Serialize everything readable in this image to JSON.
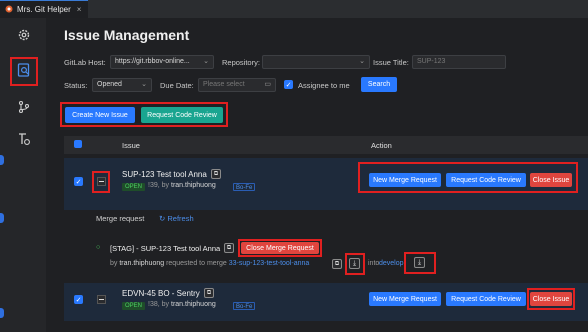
{
  "tab": {
    "title": "Mrs. Git Helper",
    "close": "×"
  },
  "colors": {
    "accent": "#2979ff",
    "teal": "#1aa590",
    "danger": "#e0453e",
    "highlight": "#e02020"
  },
  "page": {
    "title": "Issue Management"
  },
  "filters": {
    "gitlab_host_label": "GitLab Host:",
    "gitlab_host_value": "https://git.rbbov-online...",
    "repository_label": "Repository:",
    "repository_value": "",
    "issue_title_label": "Issue Title:",
    "issue_title_placeholder": "SUP-123",
    "status_label": "Status:",
    "status_value": "Opened",
    "due_date_label": "Due Date:",
    "due_date_placeholder": "Please select",
    "assignee_label": "Assignee to me",
    "search_button": "Search"
  },
  "actions": {
    "create_issue": "Create New Issue",
    "request_review": "Request Code Review"
  },
  "table": {
    "col_issue": "Issue",
    "col_action": "Action"
  },
  "rows": [
    {
      "title": "SUP-123 Test tool Anna",
      "status": "OPEN",
      "number": "!39,",
      "by": "by",
      "author": "tran.thiphuong",
      "tag": "Bo-Fe",
      "new_mr": "New Merge Request",
      "review": "Request Code Review",
      "close": "Close Issue"
    },
    {
      "title": "EDVN-45 BO - Sentry",
      "status": "OPEN",
      "number": "!38,",
      "by": "by",
      "author": "tran.thiphuong",
      "tag": "Bo-Fe",
      "new_mr": "New Merge Request",
      "review": "Request Code Review",
      "close": "Close Issue"
    }
  ],
  "merge_section": {
    "label": "Merge request",
    "refresh": "Refresh"
  },
  "merge_request": {
    "title": "[STAG] - SUP-123 Test tool Anna",
    "close_button": "Close Merge Request",
    "by": "by",
    "author": "tran.thiphuong",
    "requested": "requested to merge",
    "source_branch": "33-sup-123-test-tool-anna",
    "into": "into",
    "target_branch": "develop"
  }
}
